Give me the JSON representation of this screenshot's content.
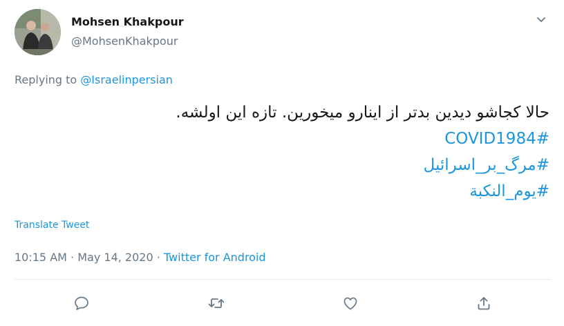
{
  "author": {
    "display_name": "Mohsen Khakpour",
    "handle": "@MohsenKhakpour"
  },
  "reply": {
    "prefix": "Replying to ",
    "to_handle": "@Israelinpersian"
  },
  "tweet": {
    "text": "حالا کجاشو دیدین بدتر از اینارو میخورین. تازه این اولشه.",
    "hashtags": [
      "#COVID1984",
      "#مرگ_بر_اسرائیل",
      "#یوم_النکبة"
    ]
  },
  "translate_label": "Translate Tweet",
  "meta": {
    "time": "10:15 AM",
    "separator1": " · ",
    "date": "May 14, 2020",
    "separator2": " · ",
    "source": "Twitter for Android"
  },
  "actions": [
    "reply-icon",
    "retweet-icon",
    "like-icon",
    "share-icon"
  ],
  "colors": {
    "link": "#1b95e0",
    "secondary_text": "#657786",
    "primary_text": "#14171a",
    "divider": "#e6ecf0"
  }
}
